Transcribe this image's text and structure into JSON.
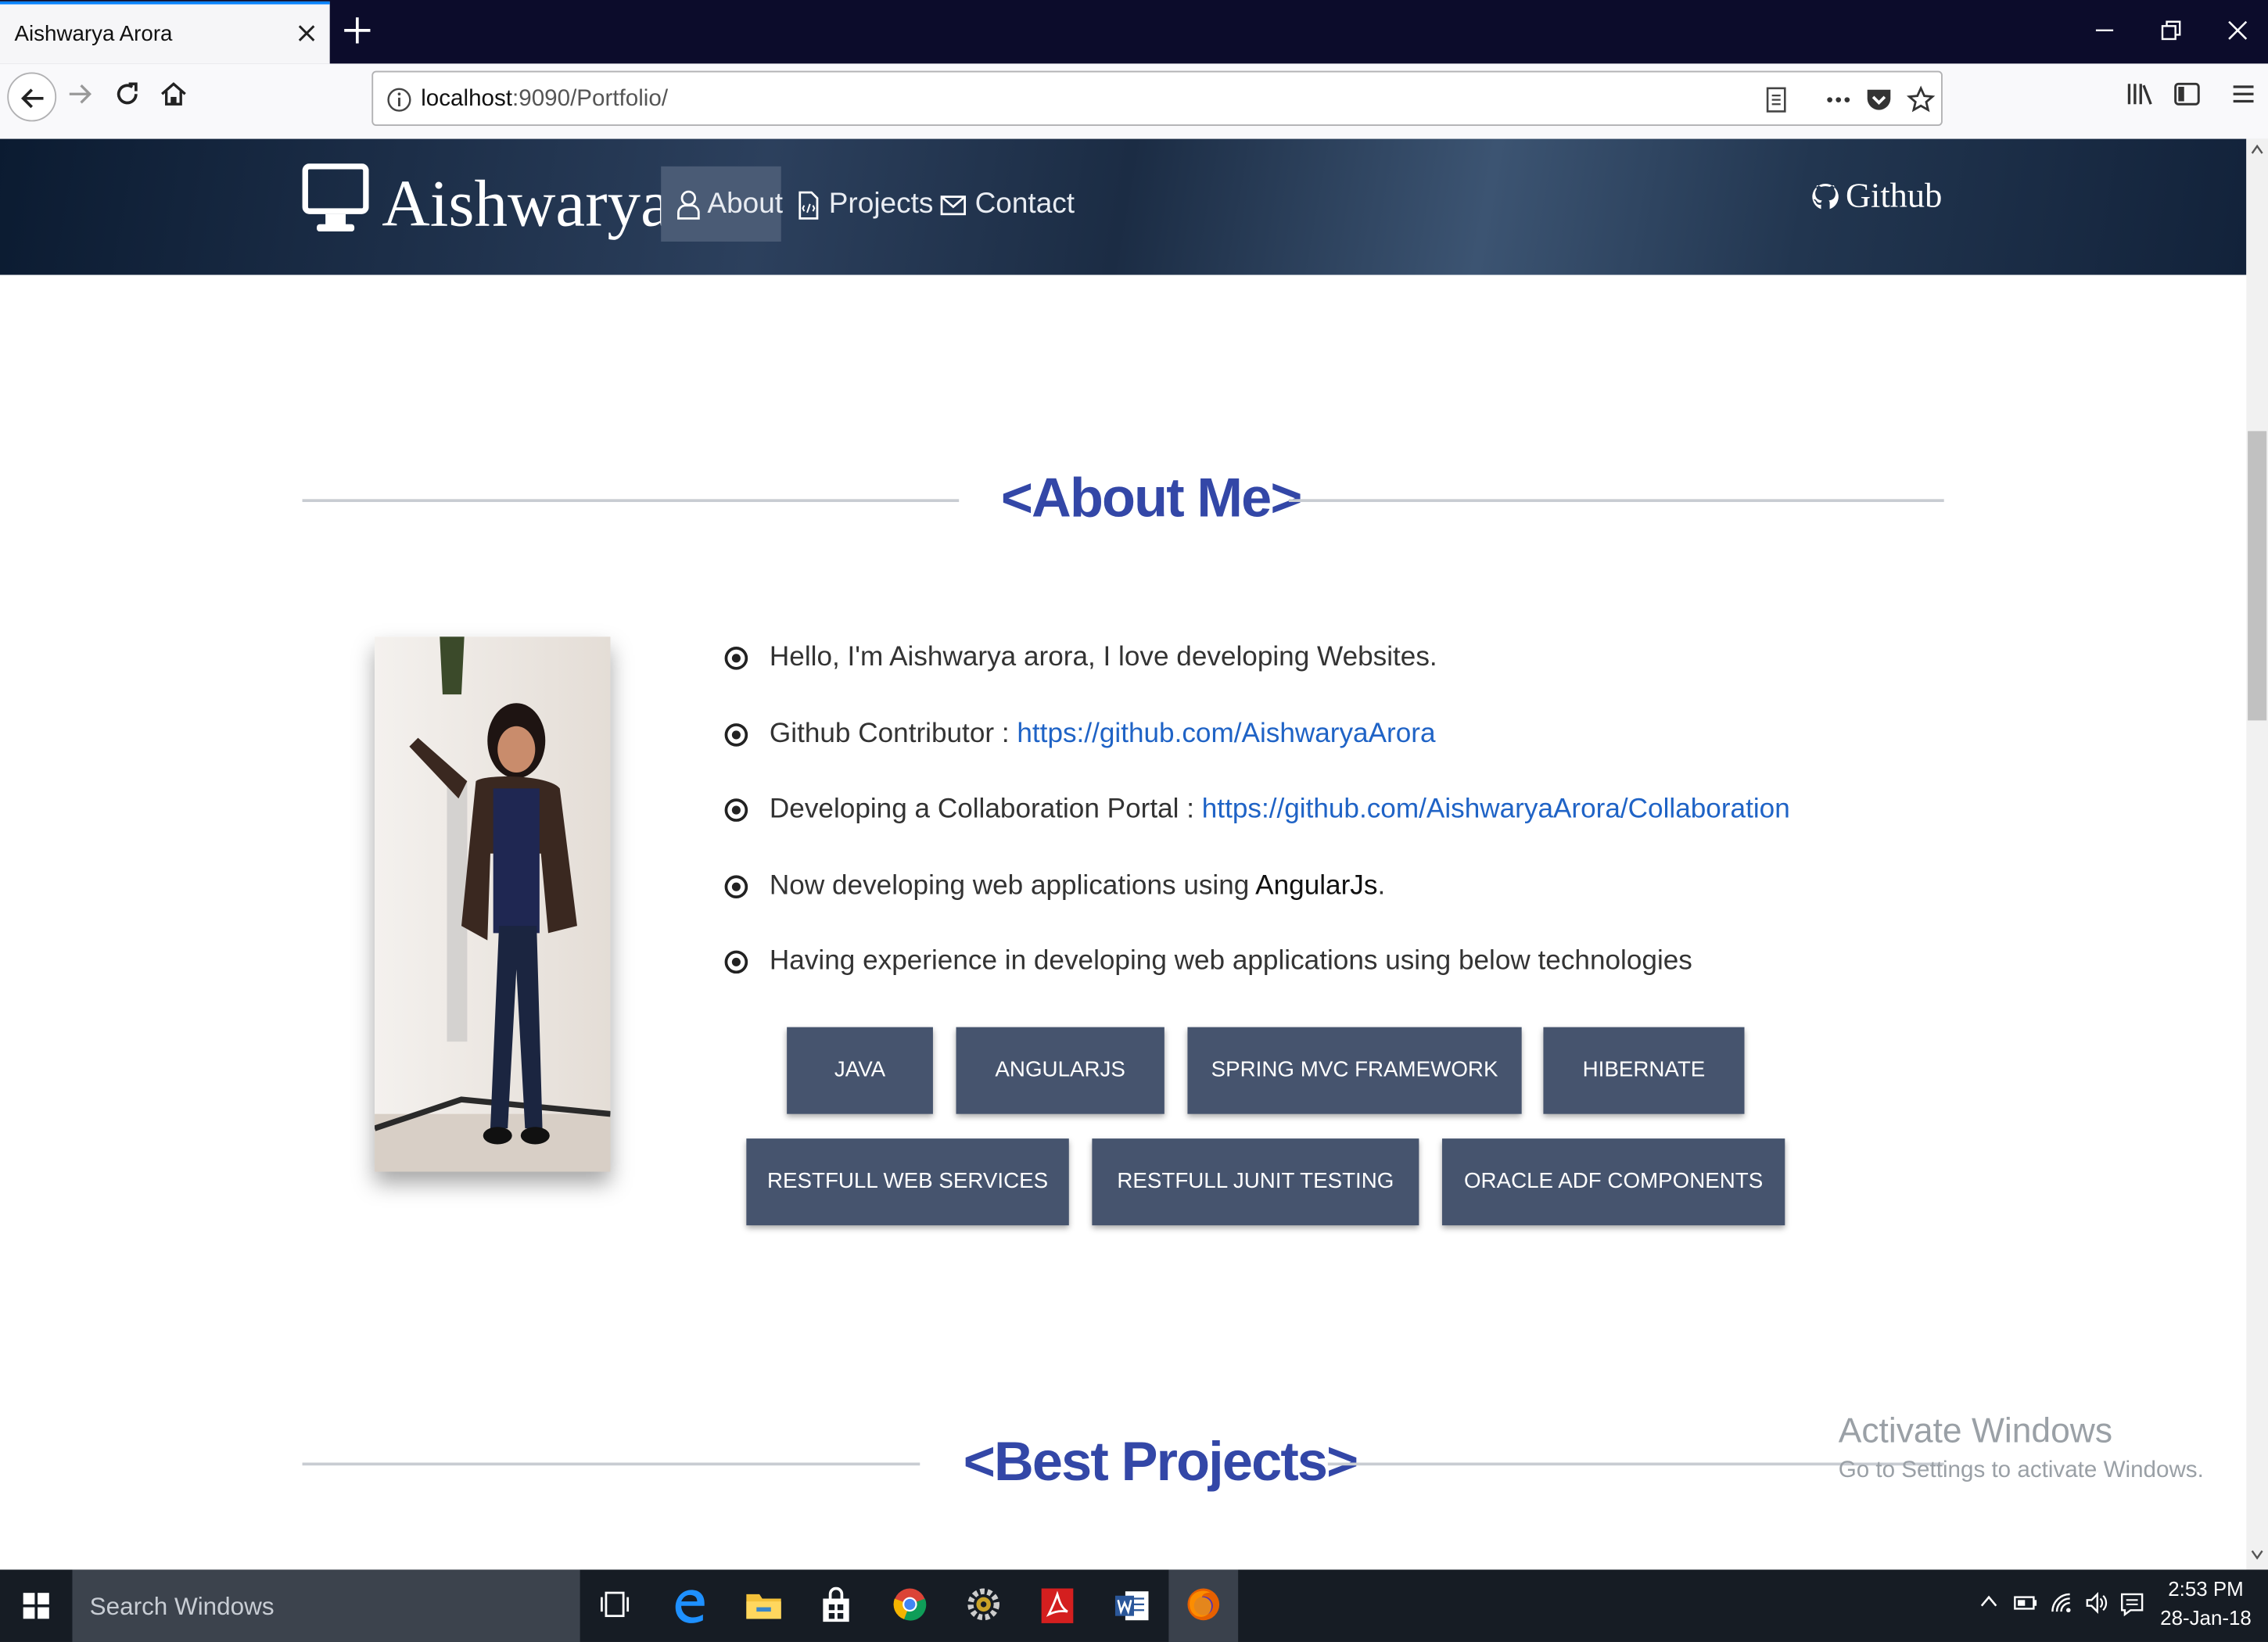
{
  "browser": {
    "tab_title": "Aishwarya Arora",
    "url_host": "localhost",
    "url_rest": ":9090/Portfolio/"
  },
  "site": {
    "brand": "Aishwarya",
    "nav": [
      {
        "label": "About",
        "icon": "user-icon",
        "active": true
      },
      {
        "label": "Projects",
        "icon": "document-icon",
        "active": false
      },
      {
        "label": "Contact",
        "icon": "envelope-icon",
        "active": false
      }
    ],
    "github_label": "Github"
  },
  "about": {
    "title": "<About Me>",
    "items": [
      {
        "text": "Hello, I'm Aishwarya arora, I love developing Websites."
      },
      {
        "text": "Github Contributor : ",
        "link": "https://github.com/AishwaryaArora"
      },
      {
        "text": "Developing a Collaboration Portal : ",
        "link": "https://github.com/AishwaryaArora/Collaboration"
      },
      {
        "text": "Now developing web applications using ",
        "emph": "AngularJs",
        "suffix": "."
      },
      {
        "text": "Having experience in developing web applications using below technologies"
      }
    ],
    "skills": [
      "JAVA",
      "ANGULARJS",
      "SPRING MVC FRAMEWORK",
      "HIBERNATE",
      "RESTFULL WEB SERVICES",
      "RESTFULL JUNIT TESTING",
      "ORACLE ADF COMPONENTS"
    ]
  },
  "projects": {
    "title": "<Best Projects>"
  },
  "watermark": {
    "line1": "Activate Windows",
    "line2": "Go to Settings to activate Windows."
  },
  "taskbar": {
    "search_placeholder": "Search Windows",
    "time": "2:53 PM",
    "date": "28-Jan-18"
  },
  "colors": {
    "accent_title": "#3347a7",
    "skill_button": "#46546e",
    "link": "#1f63c6",
    "tab_highlight": "#0a84ff"
  }
}
